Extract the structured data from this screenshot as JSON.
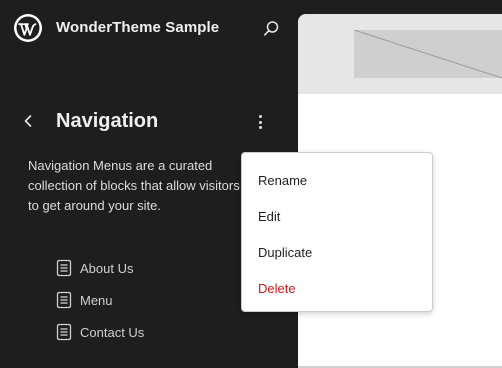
{
  "site": {
    "title": "WonderTheme Sample",
    "logo_icon": "wordpress-logo-icon",
    "search_icon": "search-icon"
  },
  "navigation": {
    "back_icon": "chevron-left-icon",
    "title": "Navigation",
    "more_icon": "more-vertical-icon",
    "description": "Navigation Menus are a curated collection of blocks that allow visitors to get around your site.",
    "menus": [
      {
        "label": "About Us",
        "icon": "page-icon"
      },
      {
        "label": "Menu",
        "icon": "page-icon"
      },
      {
        "label": "Contact Us",
        "icon": "page-icon"
      }
    ]
  },
  "actions_menu": {
    "items": [
      {
        "label": "Rename",
        "danger": false
      },
      {
        "label": "Edit",
        "danger": false
      },
      {
        "label": "Duplicate",
        "danger": false
      },
      {
        "label": "Delete",
        "danger": true
      }
    ]
  },
  "colors": {
    "sidebar_bg": "#1e1e1e",
    "danger": "#cc1818",
    "canvas_bg": "#ffffff"
  }
}
